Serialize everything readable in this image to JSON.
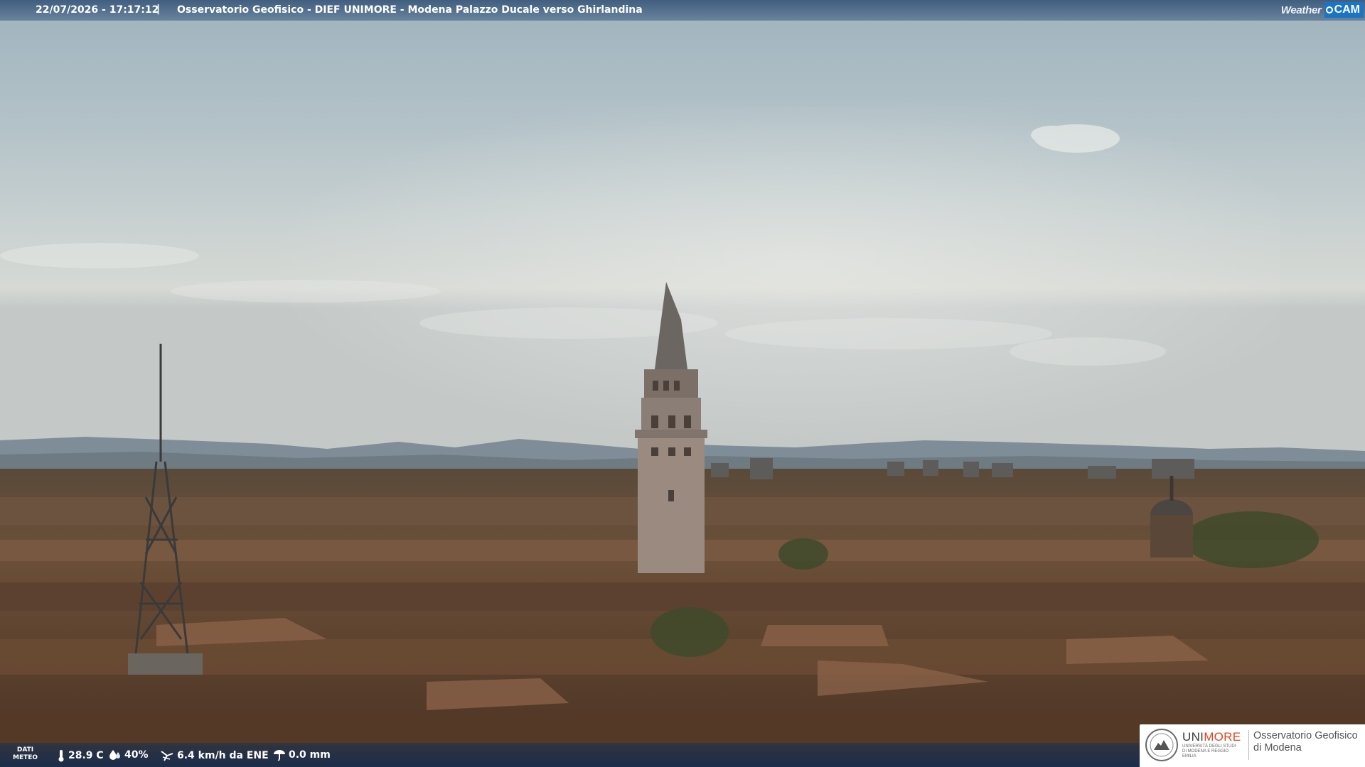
{
  "header": {
    "timestamp": "22/07/2026 - 17:17:12",
    "separator": "|",
    "title": "Osservatorio Geofisico - DIEF UNIMORE - Modena Palazzo Ducale verso Ghirlandina"
  },
  "brand": {
    "weather": "Weather",
    "cam": "CAM",
    "accent": "#1c74c4"
  },
  "weather": {
    "label_line1": "DATI",
    "label_line2": "METEO",
    "temperature": "28.9 C",
    "humidity": "40%",
    "wind": "6.4 km/h da ENE",
    "rain": "0.0 mm",
    "icons": [
      "thermometer-icon",
      "humidity-icon",
      "wind-icon",
      "rain-gauge-icon"
    ]
  },
  "org_logo": {
    "uni_a": "UNI",
    "uni_b": "MORE",
    "uni_sub": "UNIVERSITÀ DEGLI STUDI DI MODENA E REGGIO EMILIA",
    "org_line1": "Osservatorio Geofisico",
    "org_line2": "di Modena",
    "accent": "#e4461f"
  }
}
